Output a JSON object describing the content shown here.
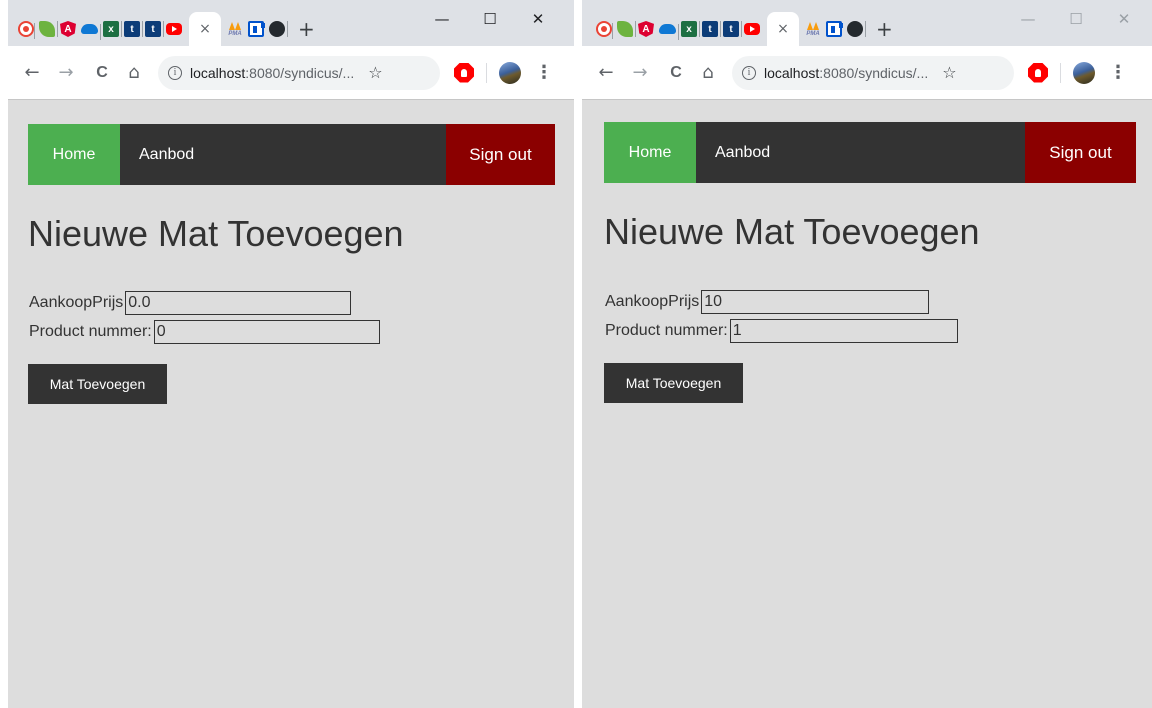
{
  "windows": [
    {
      "browser": {
        "tab_close_glyph": "×",
        "new_tab_glyph": "+",
        "controls": {
          "minimize": "—",
          "maximize": "☐",
          "close": "✕"
        },
        "nav": {
          "back": "←",
          "forward": "→",
          "reload": "C",
          "home": "⌂"
        },
        "url_host": "localhost",
        "url_rest": ":8080/syndicus/...",
        "info_glyph": "i",
        "star_glyph": "☆",
        "menu_glyph": "⋮"
      },
      "app": {
        "nav_home": "Home",
        "nav_aanbod": "Aanbod",
        "nav_signout": "Sign out",
        "title": "Nieuwe Mat Toevoegen",
        "price_label": "AankoopPrijs",
        "price_value": "0.0",
        "product_label": "Product nummer:",
        "product_value": "0",
        "submit_label": "Mat Toevoegen"
      }
    },
    {
      "browser": {
        "tab_close_glyph": "×",
        "new_tab_glyph": "+",
        "controls": {
          "minimize": "—",
          "maximize": "☐",
          "close": "✕"
        },
        "nav": {
          "back": "←",
          "forward": "→",
          "reload": "C",
          "home": "⌂"
        },
        "url_host": "localhost",
        "url_rest": ":8080/syndicus/...",
        "info_glyph": "i",
        "star_glyph": "☆",
        "menu_glyph": "⋮"
      },
      "app": {
        "nav_home": "Home",
        "nav_aanbod": "Aanbod",
        "nav_signout": "Sign out",
        "title": "Nieuwe Mat Toevoegen",
        "price_label": "AankoopPrijs",
        "price_value": "10",
        "product_label": "Product nummer:",
        "product_value": "1",
        "submit_label": "Mat Toevoegen"
      }
    }
  ],
  "icons": [
    "recorder-icon",
    "spring-leaf-icon",
    "angular-icon",
    "onedrive-cloud-icon",
    "excel-icon",
    "t-app-icon",
    "t-app-icon",
    "youtube-icon",
    "phpmyadmin-icon",
    "board-icon",
    "github-icon",
    "stop-extension-icon",
    "profile-avatar"
  ]
}
